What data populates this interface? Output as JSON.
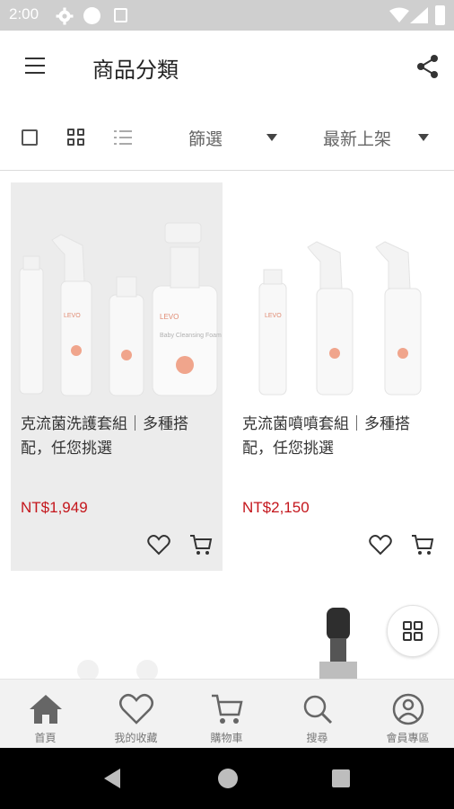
{
  "status_bar": {
    "time": "2:00",
    "icons": [
      "gear-icon",
      "circle-icon",
      "a-notification-icon",
      "wifi-icon",
      "signal-icon",
      "battery-icon"
    ]
  },
  "app_bar": {
    "title": "商品分類",
    "menu_icon": "hamburger-icon",
    "share_icon": "share-icon"
  },
  "filter_bar": {
    "view_modes": [
      "single-view-icon",
      "grid-view-icon",
      "list-view-icon"
    ],
    "filter_label": "篩選",
    "sort_label": "最新上架"
  },
  "products": [
    {
      "title": "克流菌洗護套組｜多種搭配，任您挑選",
      "price": "NT$1,949",
      "image_brand_text": "LEVO",
      "image_bottle_label": "Baby Cleansing Foam"
    },
    {
      "title": "克流菌噴噴套組｜多種搭配，任您挑選",
      "price": "NT$2,150",
      "image_brand_text": "LEVO"
    }
  ],
  "bottom_nav": {
    "items": [
      {
        "label": "首頁",
        "icon": "home-icon"
      },
      {
        "label": "我的收藏",
        "icon": "heart-icon"
      },
      {
        "label": "購物車",
        "icon": "cart-icon"
      },
      {
        "label": "搜尋",
        "icon": "search-icon"
      },
      {
        "label": "會員專區",
        "icon": "user-icon"
      }
    ]
  },
  "colors": {
    "price": "#c4161c",
    "selected_card_bg": "#ececec",
    "status_bar_bg": "#cfcfcf",
    "bottom_nav_bg": "#f2f2f2"
  }
}
